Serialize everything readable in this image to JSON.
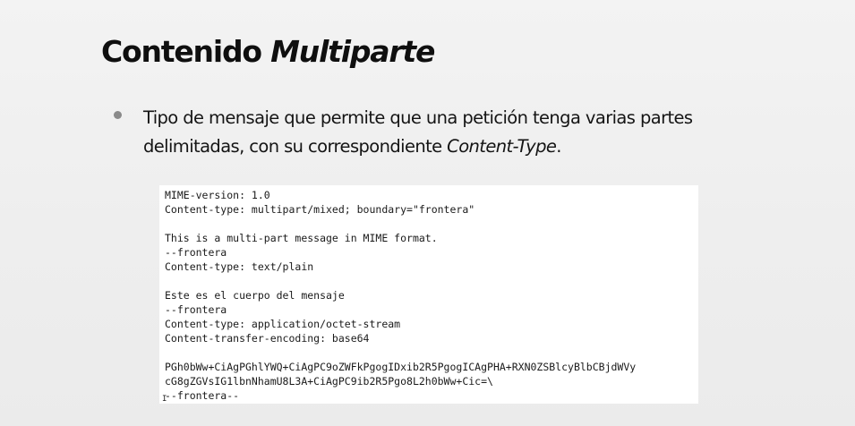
{
  "slide": {
    "title": {
      "regular": "Contenido",
      "italic": "Multiparte"
    },
    "bullet": {
      "text_before": "Tipo de mensaje que permite que una petición tenga varias partes delimitadas, con su correspondiente ",
      "text_italic": "Content-Type",
      "text_after": "."
    },
    "code_lines": [
      "MIME-version: 1.0",
      "Content-type: multipart/mixed; boundary=\"frontera\"",
      "",
      "This is a multi-part message in MIME format.",
      "--frontera",
      "Content-type: text/plain",
      "",
      "Este es el cuerpo del mensaje",
      "--frontera",
      "Content-type: application/octet-stream",
      "Content-transfer-encoding: base64",
      "",
      "PGh0bWw+CiAgPGhlYWQ+CiAgPC9oZWFkPgogIDxib2R5PgogICAgPHA+RXN0ZSBlcyBlbCBjdWVy",
      "cG8gZGVsIG1lbnNhamU8L3A+CiAgPC9ib2R5Pgo8L2h0bWw+Cic=\\",
      "--frontera--"
    ]
  }
}
